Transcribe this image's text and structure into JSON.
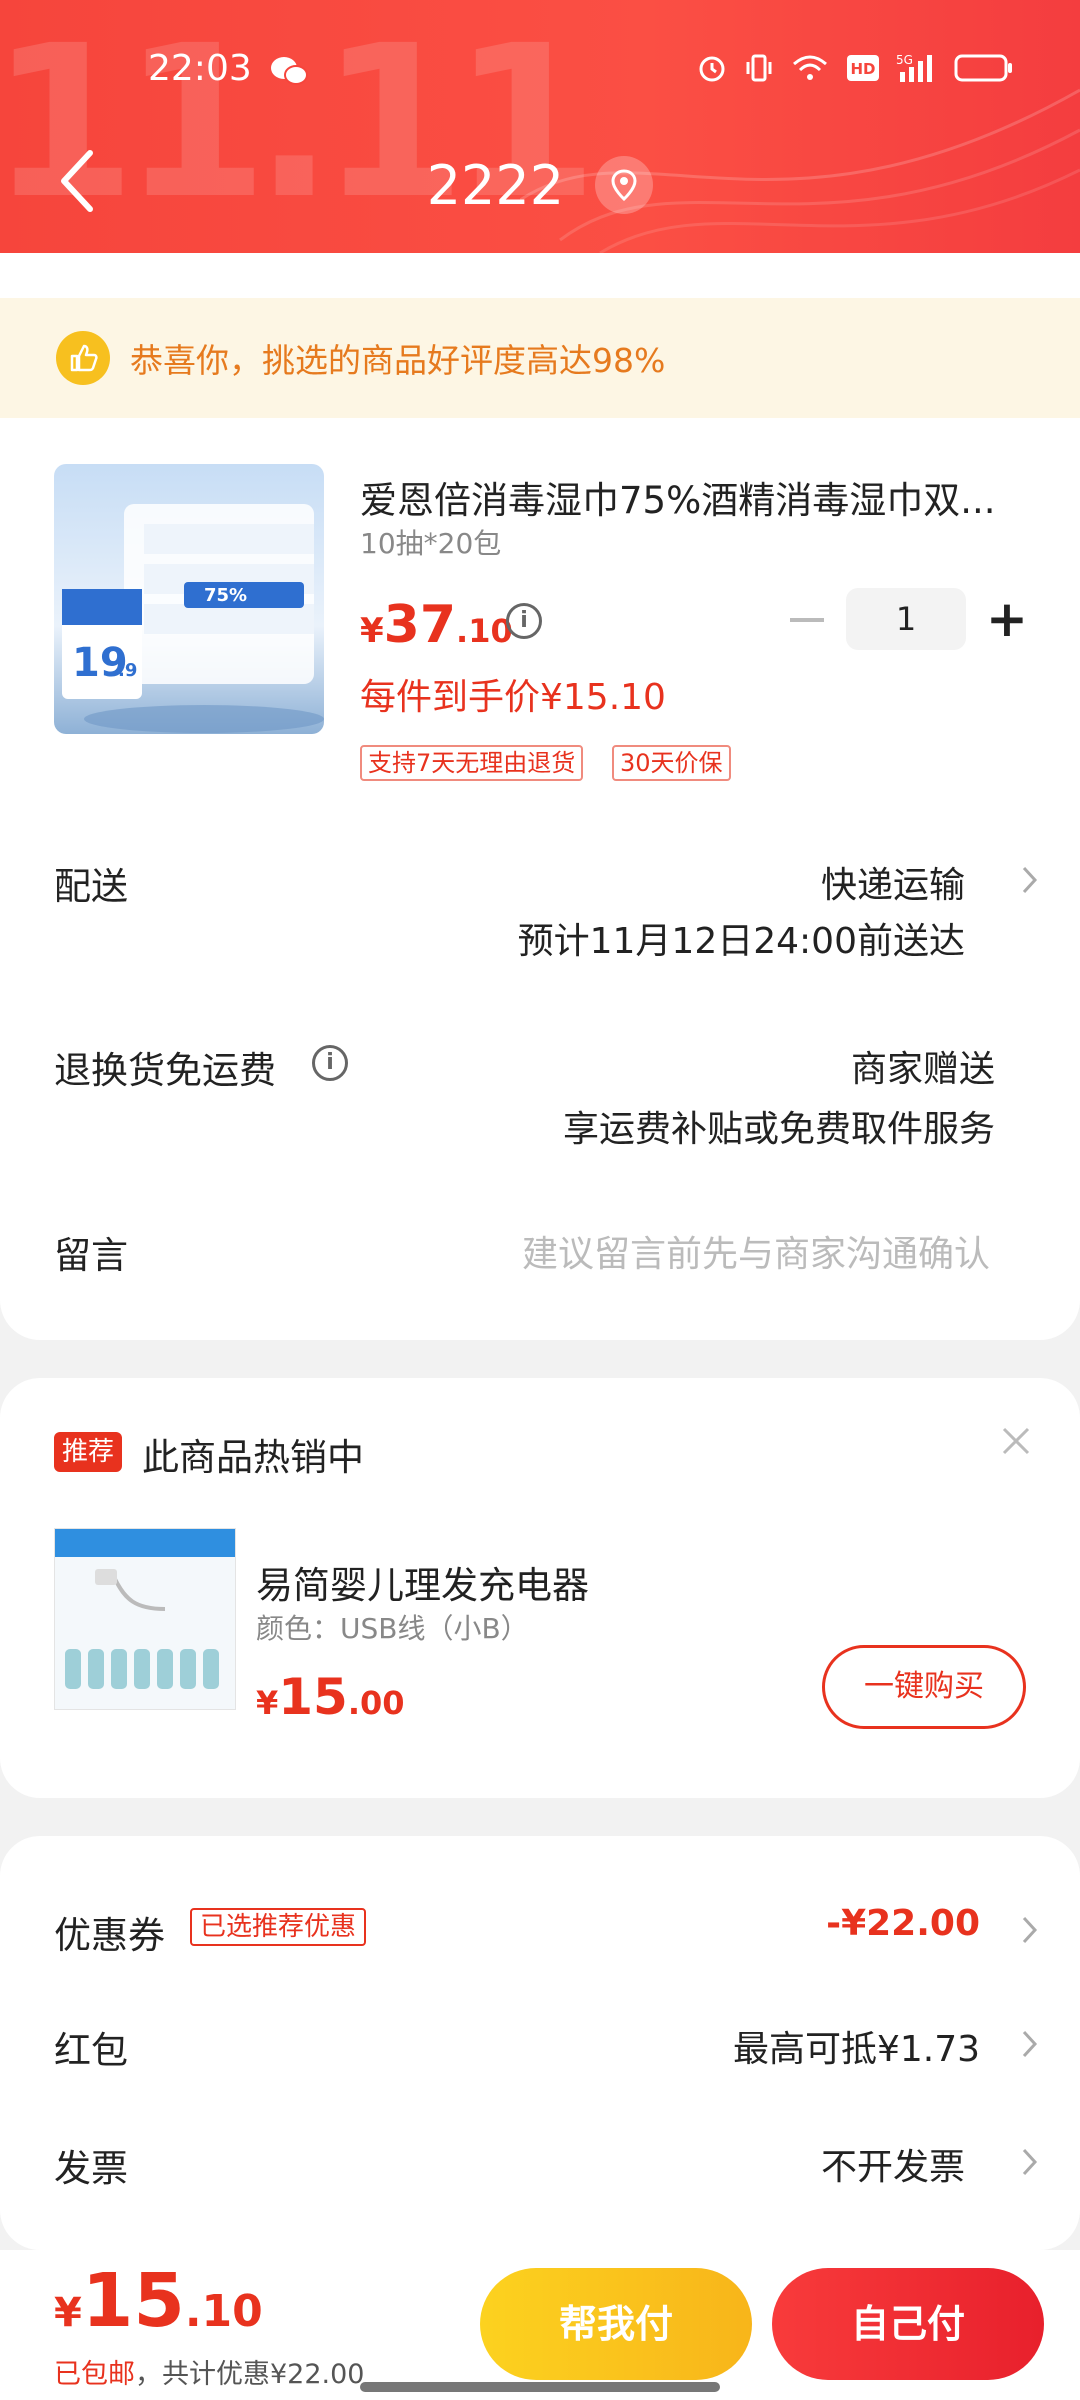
{
  "status_bar": {
    "time": "22:03"
  },
  "header": {
    "address": "2222"
  },
  "congrats": {
    "text": "恭喜你，挑选的商品好评度高达98%"
  },
  "product": {
    "title": "爱恩倍消毒湿巾75%酒精消毒湿巾双...",
    "spec": "10抽*20包",
    "price_symbol": "¥",
    "price_int": "37",
    "price_dec": ".10",
    "quantity": "1",
    "unit_price": "每件到手价¥15.10",
    "tags": [
      "支持7天无理由退货",
      "30天价保"
    ],
    "image_text": {
      "price": "19",
      "price_dec": ".9",
      "percent": "75%"
    }
  },
  "delivery": {
    "label": "配送",
    "method": "快递运输",
    "eta": "预计11月12日24:00前送达"
  },
  "return_fee": {
    "label": "退换货免运费",
    "value": "商家赠送",
    "desc": "享运费补贴或免费取件服务"
  },
  "message": {
    "label": "留言",
    "placeholder": "建议留言前先与商家沟通确认"
  },
  "recommend": {
    "badge": "推荐",
    "title": "此商品热销中",
    "product_name": "易简婴儿理发充电器",
    "product_spec": "颜色：USB线（小B）",
    "price_symbol": "¥",
    "price_int": "15",
    "price_dec": ".00",
    "button": "一键购买"
  },
  "coupon": {
    "label": "优惠券",
    "tag": "已选推荐优惠",
    "value": "-¥22.00"
  },
  "red_packet": {
    "label": "红包",
    "value": "最高可抵¥1.73"
  },
  "invoice": {
    "label": "发票",
    "value": "不开发票"
  },
  "bottom": {
    "price_symbol": "¥",
    "price_int": "15",
    "price_dec": ".10",
    "free_shipping": "已包邮",
    "discount_note": "，共计优惠¥22.00",
    "help_pay": "帮我付",
    "self_pay": "自己付"
  },
  "colors": {
    "accent_red": "#e8321e",
    "header_red": "#f6453c",
    "help_yellow": "#fcd21f"
  }
}
